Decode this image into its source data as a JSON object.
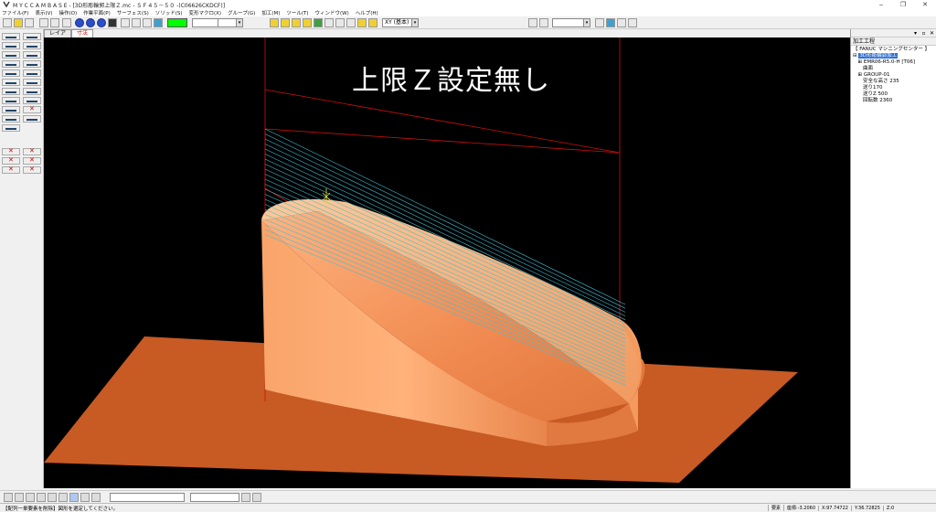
{
  "window": {
    "title": "M Y C  C A M B A S E  - [3D形彫輪郭上限Ｚ.mc - ＳＦ４５－５０ -(C06626CKDCF)]",
    "controls": [
      "‒",
      "❐",
      "✕"
    ]
  },
  "menu": [
    "ファイル(F)",
    "表示(V)",
    "操作(O)",
    "作業平面(P)",
    "サーフェス(S)",
    "ソリッド(S)",
    "変形マクロ(X)",
    "グループ(G)",
    "加工(M)",
    "ツール(T)",
    "ウィンドウ(W)",
    "ヘルプ(H)"
  ],
  "toolbar": {
    "color_swatch": "#00ff00",
    "view_select": "XY (基本)"
  },
  "tabs": [
    {
      "label": "レイア",
      "active": false
    },
    {
      "label": "寸法",
      "active": true
    }
  ],
  "viewport": {
    "overlay_text": "上限Ｚ設定無し"
  },
  "right_panel": {
    "header": "加工工程",
    "machine": "【 FANUC  マシニングセンター 】",
    "selected": "3D形彫輪郭加工",
    "items": [
      "EMR06-R5.0-H [T06]",
      "曲面",
      "GROUP-01",
      "安全な高さ 235",
      "送り170",
      "送りZ 500",
      "回転数 2360"
    ]
  },
  "status": {
    "message": "【配列一単要素を削除】図形を選定してください。",
    "fields": [
      "要素",
      "座標:-3.2060",
      "X:97.74722",
      "Y:36.72825",
      "Z:0"
    ]
  }
}
